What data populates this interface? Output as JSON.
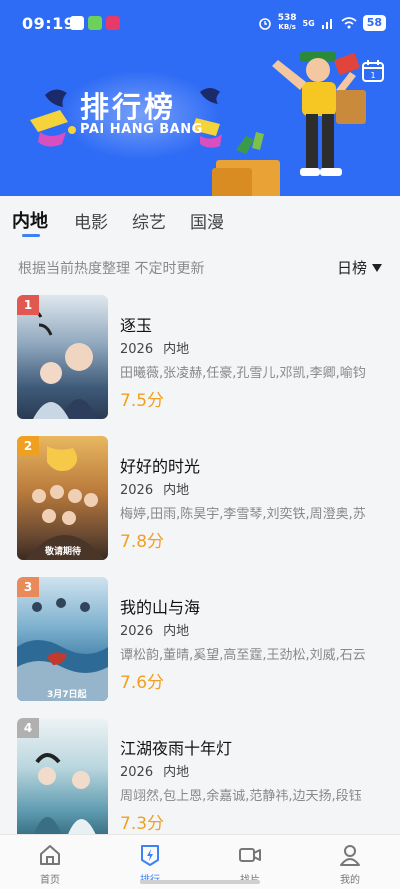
{
  "status_bar": {
    "time": "09:19",
    "net_speed_value": "538",
    "net_speed_unit": "KB/s",
    "signal": "5G",
    "battery": "58"
  },
  "banner": {
    "title": "排行榜",
    "subtitle": "PAI HANG BANG",
    "calendar_icon": "calendar-icon",
    "colors": {
      "background": "#2f6cf5",
      "accent": "#ffffff"
    }
  },
  "tabs": [
    {
      "label": "内地",
      "active": true
    },
    {
      "label": "电影",
      "active": false
    },
    {
      "label": "综艺",
      "active": false
    },
    {
      "label": "国漫",
      "active": false
    }
  ],
  "list_header": {
    "description": "根据当前热度整理 不定时更新",
    "rank_type": "日榜"
  },
  "items": [
    {
      "rank": "1",
      "title": "逐玉",
      "year": "2026",
      "region": "内地",
      "cast": "田曦薇,张凌赫,任豪,孔雪儿,邓凯,李卿,喻钧",
      "score": "7.5分"
    },
    {
      "rank": "2",
      "title": "好好的时光",
      "year": "2026",
      "region": "内地",
      "cast": "梅婷,田雨,陈昊宇,李雪琴,刘奕铁,周澄奥,苏",
      "score": "7.8分",
      "poster_note": "敬请期待"
    },
    {
      "rank": "3",
      "title": "我的山与海",
      "year": "2026",
      "region": "内地",
      "cast": "谭松韵,董晴,奚望,高至霆,王劲松,刘威,石云",
      "score": "7.6分",
      "poster_note": "3月7日起"
    },
    {
      "rank": "4",
      "title": "江湖夜雨十年灯",
      "year": "2026",
      "region": "内地",
      "cast": "周翊然,包上恩,余嘉诚,范静祎,边天扬,段钰",
      "score": "7.3分"
    }
  ],
  "bottom_nav": [
    {
      "label": "首页",
      "icon": "home-icon",
      "active": false
    },
    {
      "label": "排行",
      "icon": "ranking-icon",
      "active": true
    },
    {
      "label": "找片",
      "icon": "video-camera-icon",
      "active": false
    },
    {
      "label": "我的",
      "icon": "person-icon",
      "active": false
    }
  ],
  "colors": {
    "accent": "#3b82f6",
    "score": "#f0a020",
    "rank_badges": [
      "#e0584f",
      "#f0a020",
      "#e88a5a",
      "#b0b0b0"
    ]
  }
}
